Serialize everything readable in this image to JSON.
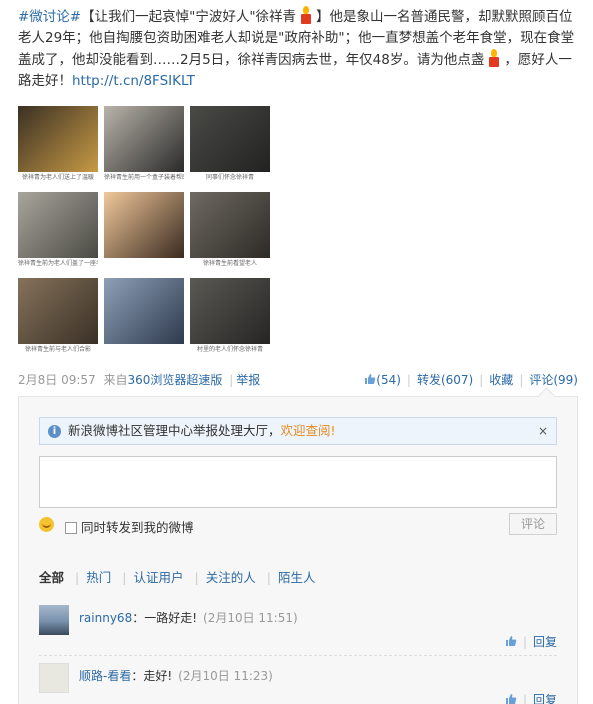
{
  "post": {
    "topic": "#微讨论#",
    "t1": "【让我们一起哀悼\"宁波好人\"徐祥青",
    "t2": "】他是象山一名普通民警，却默默照顾百位老人29年；他自掏腰包资助困难老人却说是\"政府补助\"；他一直梦想盖个老年食堂，现在食堂盖成了，他却没能看到……2月5日，徐祥青因病去世，年仅48岁。请为他点盏",
    "t3": "，愿好人一路走好！",
    "link": "http://t.cn/8FSIKLT"
  },
  "photos": [
    {
      "caption": "徐祥青为老人们送上了温暖",
      "bg": "#3a3024",
      "accent": "#c79a45"
    },
    {
      "caption": "徐祥青生前用一个盒子装着帮助老人的清单",
      "bg": "#b9b4aa",
      "accent": "#2a2a2a"
    },
    {
      "caption": "同事们怀念徐祥青",
      "bg": "#4a4a46",
      "accent": "#222"
    },
    {
      "caption": "徐祥青生前为老人们盖了一座老年食堂",
      "bg": "#a9a59c",
      "accent": "#4a4a44"
    },
    {
      "caption": "",
      "bg": "#f0c89a",
      "accent": "#3a2a20"
    },
    {
      "caption": "徐祥青生前看望老人",
      "bg": "#6f6a62",
      "accent": "#2d2a26"
    },
    {
      "caption": "徐祥青生前与老人们合影",
      "bg": "#85725a",
      "accent": "#3a3026"
    },
    {
      "caption": "",
      "bg": "#8ea0b6",
      "accent": "#2e3a4e"
    },
    {
      "caption": "村里的老人们怀念徐祥青",
      "bg": "#5b5954",
      "accent": "#262523"
    }
  ],
  "meta": {
    "time": "2月8日 09:57",
    "source_prefix": "来自",
    "source_app": "360浏览器超速版",
    "report": "举报",
    "likes": "(54)",
    "repost": "转发(607)",
    "favorite": "收藏",
    "comments": "评论(99)"
  },
  "notice": {
    "text": "新浪微博社区管理中心举报处理大厅，",
    "link": "欢迎查阅!",
    "close": "×"
  },
  "composer": {
    "repost_label": "同时转发到我的微博",
    "submit": "评论"
  },
  "filters": [
    "全部",
    "热门",
    "认证用户",
    "关注的人",
    "陌生人"
  ],
  "comments": [
    {
      "user": "rainny68",
      "text": "：一路好走!",
      "time": "(2月10日 11:51)",
      "reply": "回复"
    },
    {
      "user": "顺路-看看",
      "text": "：走好!",
      "time": "(2月10日 11:23)",
      "reply": "回复"
    }
  ],
  "colors": {
    "link": "#2b6aa6",
    "accent": "#e58a1f"
  }
}
